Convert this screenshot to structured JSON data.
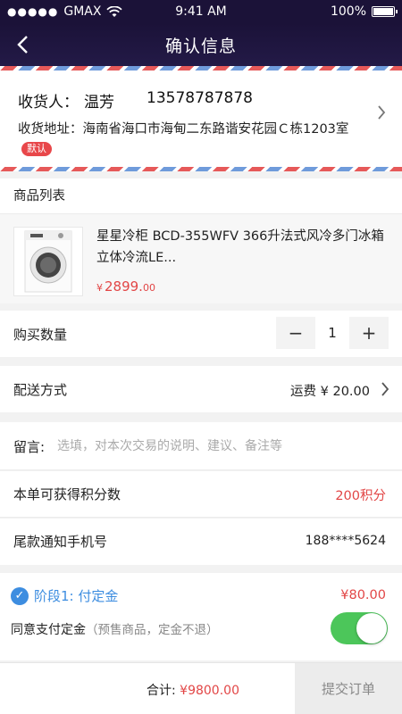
{
  "status_bar": {
    "carrier": "GMAX",
    "time": "9:41 AM",
    "battery": "100%"
  },
  "nav": {
    "title": "确认信息"
  },
  "address": {
    "name_label": "收货人：",
    "name": "温芳",
    "phone": "13578787878",
    "addr_label": "收货地址：",
    "addr": "海南省海口市海甸二东路谐安花园Ｃ栋1203室",
    "default_badge": "默认"
  },
  "goods": {
    "header": "商品列表",
    "items": [
      {
        "name": "星星冷柜 BCD-355WFV 366升法式风冷多门冰箱 立体冷流LE...",
        "currency": "¥",
        "price_int": "2899.",
        "price_dec": "00"
      }
    ]
  },
  "quantity": {
    "label": "购买数量",
    "minus": "−",
    "value": "1",
    "plus": "+"
  },
  "shipping": {
    "label": "配送方式",
    "fee": "运费 ¥ 20.00"
  },
  "message": {
    "label": "留言:",
    "placeholder": "选填，对本次交易的说明、建议、备注等"
  },
  "points": {
    "label": "本单可获得积分数",
    "value": "200积分"
  },
  "notify_phone": {
    "label": "尾款通知手机号",
    "value": "188****5624"
  },
  "stage": {
    "title": "阶段1: 付定金",
    "amount": "¥80.00",
    "agree": "同意支付定金",
    "note": "（预售商品，定金不退）",
    "agree_on": true
  },
  "footer": {
    "total_label": "合计:",
    "total_amount": "¥9800.00",
    "submit": "提交订单"
  },
  "colors": {
    "nav_bg": "#1b1238",
    "price_red": "#e24646",
    "accent_blue": "#3d8de0",
    "toggle_green": "#4cc65a"
  }
}
